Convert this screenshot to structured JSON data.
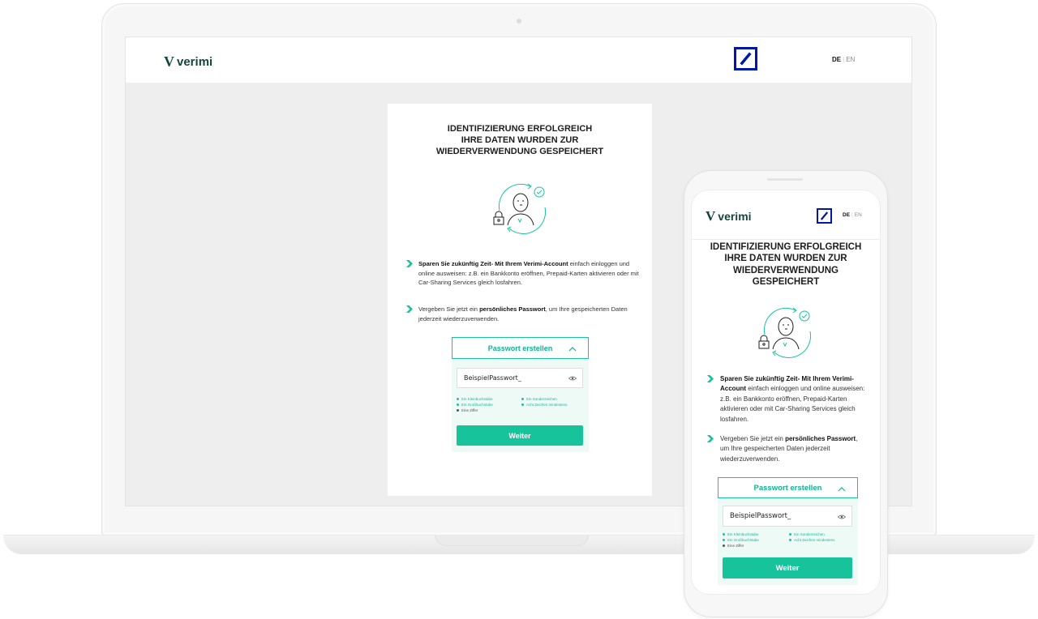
{
  "brand": {
    "name": "verimi",
    "mark": "V"
  },
  "header": {
    "lang_active": "DE",
    "lang_separator": "|",
    "lang_other": "EN"
  },
  "heading": {
    "line1": "IDENTIFIZIERUNG ERFOLGREICH",
    "line2": "IHRE DATEN WURDEN ZUR",
    "line3": "WIEDERVERWENDUNG GESPEICHERT",
    "mobile_line3": "WIEDERVERWENDUNG",
    "mobile_line4": "GESPEICHERT"
  },
  "bullets": {
    "first_bold": "Sparen Sie zukünftig Zeit- Mit Ihrem Verimi-Account",
    "first_rest": " einfach einloggen und online ausweisen: z.B. ein Bankkonto eröffnen, Prepaid-Karten aktivieren oder mit Car-Sharing Services gleich losfahren.",
    "second_pre": "Vergeben Sie jetzt ein ",
    "second_bold": "persönliches Passwort",
    "second_rest": ", um Ihre gespeicherten Daten jederzeit wiederzuverwenden."
  },
  "password": {
    "toggle_label": "Passwort erstellen",
    "value": "BeispielPasswort_",
    "rules": {
      "lowercase": "Ein Kleinbuchstabe",
      "uppercase": "Ein Großbuchstabe",
      "digit": "Eine Ziffer",
      "special": "Ein Sonderzeichen",
      "length": "Acht Zeichen mindestens"
    },
    "submit_label": "Weiter"
  },
  "colors": {
    "accent": "#17c39a",
    "brand": "#14463d",
    "bank_blue": "#0018a8"
  },
  "icons": [
    "verimi-logo",
    "deutsche-bank-logo",
    "identity-check-illustration",
    "arrow-bullet-icon",
    "chevron-up-icon",
    "eye-icon"
  ]
}
